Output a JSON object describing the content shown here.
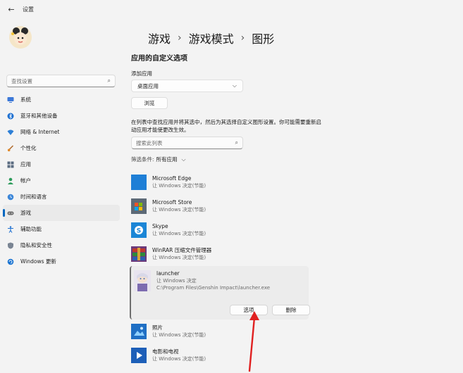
{
  "titlebar": {
    "back_label": "←",
    "title": "设置"
  },
  "sidebar": {
    "search_placeholder": "查找设置",
    "items": [
      {
        "label": "系统",
        "icon": "monitor-icon"
      },
      {
        "label": "蓝牙和其他设备",
        "icon": "bluetooth-icon"
      },
      {
        "label": "网络 & Internet",
        "icon": "network-icon"
      },
      {
        "label": "个性化",
        "icon": "brush-icon"
      },
      {
        "label": "应用",
        "icon": "apps-icon"
      },
      {
        "label": "帐户",
        "icon": "account-icon"
      },
      {
        "label": "时间和语言",
        "icon": "globe-clock-icon"
      },
      {
        "label": "游戏",
        "icon": "gamepad-icon",
        "active": true
      },
      {
        "label": "辅助功能",
        "icon": "accessibility-icon"
      },
      {
        "label": "隐私和安全性",
        "icon": "shield-icon"
      },
      {
        "label": "Windows 更新",
        "icon": "update-icon"
      }
    ]
  },
  "breadcrumb": {
    "part1": "游戏",
    "part2": "游戏模式",
    "part3": "图形",
    "sep": "›"
  },
  "section_title": "应用的自定义选项",
  "add_app": {
    "label": "添加应用",
    "dropdown_value": "桌面应用",
    "browse_label": "浏览"
  },
  "description": "在列表中查找应用并将其选中，然后为其选择自定义图形设置。你可能需要重新启动应用才能使更改生效。",
  "list_search_placeholder": "搜索此列表",
  "filter": {
    "label": "筛选条件:",
    "value": "所有应用"
  },
  "apps": [
    {
      "name": "Microsoft Edge",
      "sub": "让 Windows 决定(节能)",
      "icon": "edge-icon"
    },
    {
      "name": "Microsoft Store",
      "sub": "让 Windows 决定(节能)",
      "icon": "store-icon"
    },
    {
      "name": "Skype",
      "sub": "让 Windows 决定(节能)",
      "icon": "skype-icon"
    },
    {
      "name": "WinRAR 压缩文件管理器",
      "sub": "让 Windows 决定(节能)",
      "icon": "winrar-icon"
    }
  ],
  "expanded_app": {
    "name": "launcher",
    "sub": "让 Windows 决定",
    "path": "C:\\Program Files\\Genshin Impact\\launcher.exe",
    "options_label": "选项",
    "remove_label": "删除"
  },
  "apps_after": [
    {
      "name": "照片",
      "sub": "让 Windows 决定(节能)",
      "icon": "photos-icon"
    },
    {
      "name": "电影和电视",
      "sub": "让 Windows 决定(节能)",
      "icon": "movies-icon"
    }
  ],
  "colors": {
    "accent": "#0067c0",
    "arrow": "#e02020",
    "background": "#f3f3f3"
  }
}
